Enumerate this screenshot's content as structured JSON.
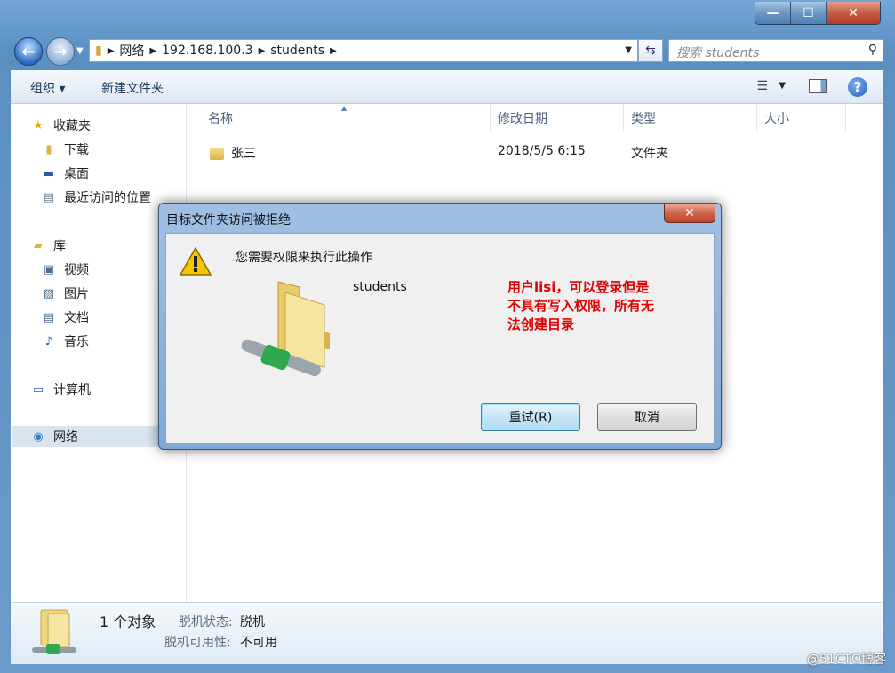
{
  "window": {
    "caption_buttons": {
      "minimize": "—",
      "maximize": "☐",
      "close": "✕"
    }
  },
  "address": {
    "segments": [
      "网络",
      "192.168.100.3",
      "students"
    ],
    "search_placeholder": "搜索 students"
  },
  "toolbar": {
    "organize": "组织 ▾",
    "new_folder": "新建文件夹"
  },
  "nav": {
    "favorites": "收藏夹",
    "downloads": "下载",
    "desktop": "桌面",
    "recent": "最近访问的位置",
    "libraries": "库",
    "videos": "视频",
    "pictures": "图片",
    "documents": "文档",
    "music": "音乐",
    "computer": "计算机",
    "network": "网络"
  },
  "columns": {
    "name": "名称",
    "modified": "修改日期",
    "type": "类型",
    "size": "大小"
  },
  "files": [
    {
      "name": "张三",
      "modified": "2018/5/5 6:15",
      "type": "文件夹",
      "size": ""
    }
  ],
  "status": {
    "count": "1 个对象",
    "offline_status_label": "脱机状态:",
    "offline_status_value": "脱机",
    "offline_avail_label": "脱机可用性:",
    "offline_avail_value": "不可用"
  },
  "dialog": {
    "title": "目标文件夹访问被拒绝",
    "message": "您需要权限来执行此操作",
    "folder_name": "students",
    "annotation": "用户lisi，可以登录但是不具有写入权限，所有无法创建目录",
    "retry": "重试(R)",
    "cancel": "取消"
  },
  "watermark": "@51CTO博客",
  "colors": {
    "annotation": "#e00000",
    "accent": "#1f5dbd"
  }
}
